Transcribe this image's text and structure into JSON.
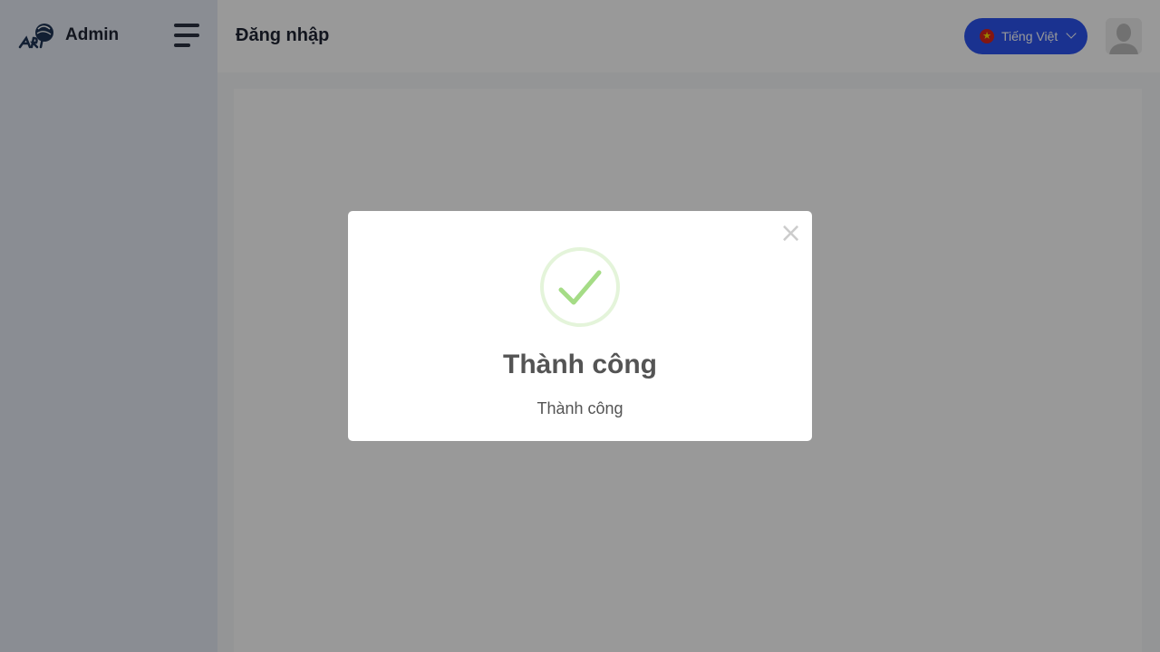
{
  "brand": {
    "name": "Admin",
    "logo_icon": "logo-icon"
  },
  "header": {
    "title": "Đăng nhập",
    "language": {
      "label": "Tiếng Việt",
      "flag_icon": "vietnam-flag-icon"
    },
    "menu_icon": "hamburger-menu-icon",
    "avatar_icon": "user-avatar-icon"
  },
  "modal": {
    "icon": "success-check-icon",
    "title": "Thành công",
    "text": "Thành công",
    "close_label": "×"
  },
  "colors": {
    "accent": "#2c54f0",
    "success": "#a5dc86",
    "sidebar_bg": "#e6ebf5",
    "overlay": "rgba(0,0,0,0.4)"
  }
}
